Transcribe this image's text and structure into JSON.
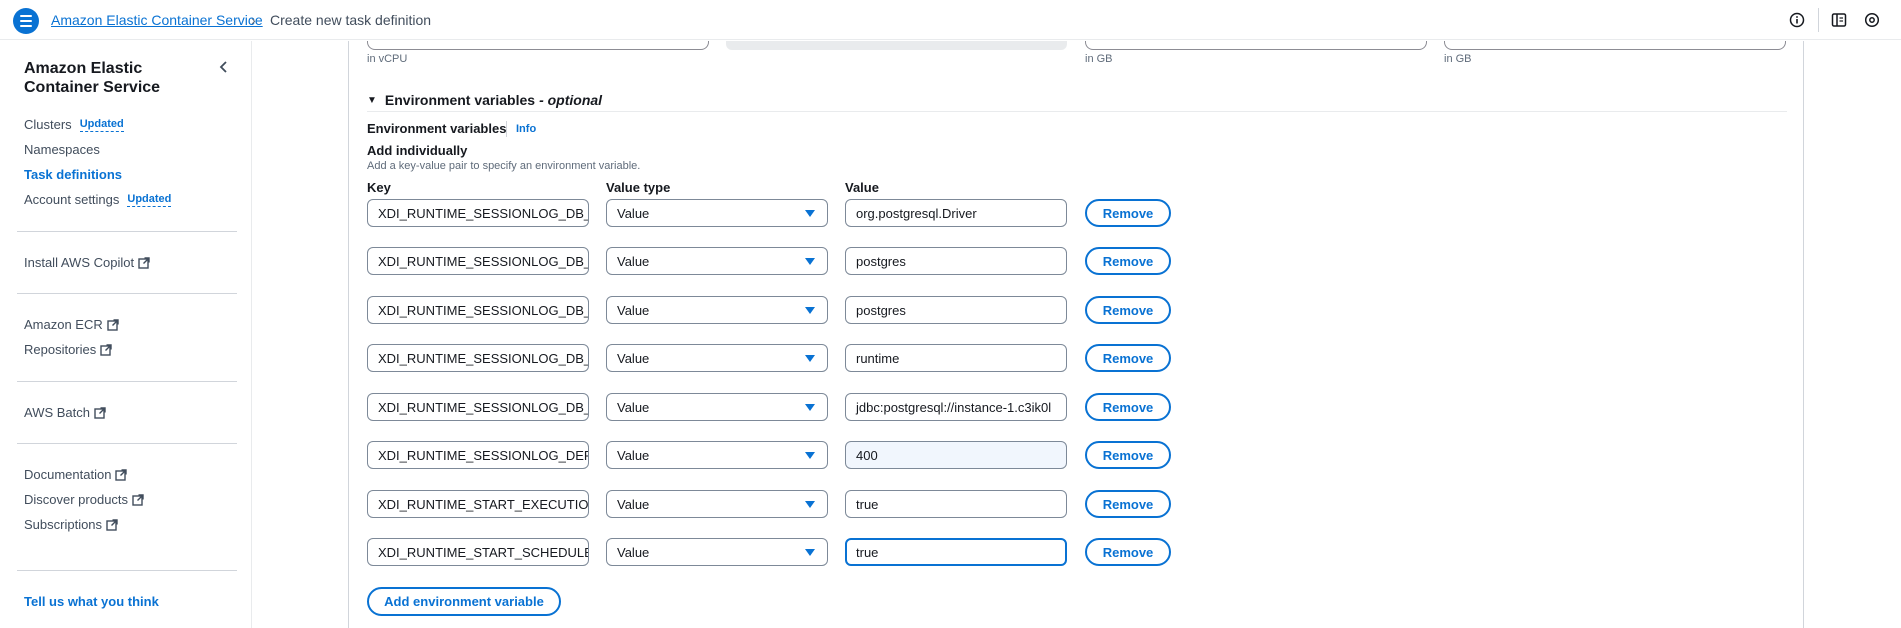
{
  "header": {
    "service_link": "Amazon Elastic Container Service",
    "separator": "›",
    "current_page": "Create new task definition"
  },
  "sidebar": {
    "title": "Amazon Elastic Container Service",
    "badge": "Updated",
    "items": [
      {
        "label": "Clusters",
        "badge": "Updated"
      },
      {
        "label": "Namespaces"
      },
      {
        "label": "Task definitions",
        "active": true
      },
      {
        "label": "Account settings",
        "badge": "Updated"
      },
      {
        "label": "Install AWS Copilot",
        "external": true
      },
      {
        "label": "Amazon ECR",
        "external": true
      },
      {
        "label": "Repositories",
        "external": true
      },
      {
        "label": "AWS Batch",
        "external": true
      },
      {
        "label": "Documentation",
        "external": true
      },
      {
        "label": "Discover products",
        "external": true
      },
      {
        "label": "Subscriptions",
        "external": true
      }
    ],
    "feedback": "Tell us what you think"
  },
  "resources": {
    "cpu_hint": "in vCPU",
    "memory_hint": "in GB",
    "memory_reserve_hint": "in GB"
  },
  "env": {
    "section_title": "Environment variables",
    "section_optional": "- optional",
    "label": "Environment variables",
    "info": "Info",
    "add_individually": "Add individually",
    "description": "Add a key-value pair to specify an environment variable.",
    "col_key": "Key",
    "col_type": "Value type",
    "col_value": "Value",
    "remove_label": "Remove",
    "add_button": "Add environment variable",
    "rows": [
      {
        "key": "XDI_RUNTIME_SESSIONLOG_DB_JI",
        "type": "Value",
        "value": "org.postgresql.Driver"
      },
      {
        "key": "XDI_RUNTIME_SESSIONLOG_DB_JI",
        "type": "Value",
        "value": "postgres"
      },
      {
        "key": "XDI_RUNTIME_SESSIONLOG_DB_JI",
        "type": "Value",
        "value": "postgres"
      },
      {
        "key": "XDI_RUNTIME_SESSIONLOG_DB_JI",
        "type": "Value",
        "value": "runtime"
      },
      {
        "key": "XDI_RUNTIME_SESSIONLOG_DB_JI",
        "type": "Value",
        "value": "jdbc:postgresql://instance-1.c3ik0l"
      },
      {
        "key": "XDI_RUNTIME_SESSIONLOG_DEFA",
        "type": "Value",
        "value": "400"
      },
      {
        "key": "XDI_RUNTIME_START_EXECUTION",
        "type": "Value",
        "value": "true"
      },
      {
        "key": "XDI_RUNTIME_START_SCHEDULER",
        "type": "Value",
        "value": "true"
      }
    ]
  },
  "colors": {
    "accent": "#0972d3",
    "text": "#16191f",
    "muted": "#5f6b7a",
    "border": "#7d8998"
  }
}
